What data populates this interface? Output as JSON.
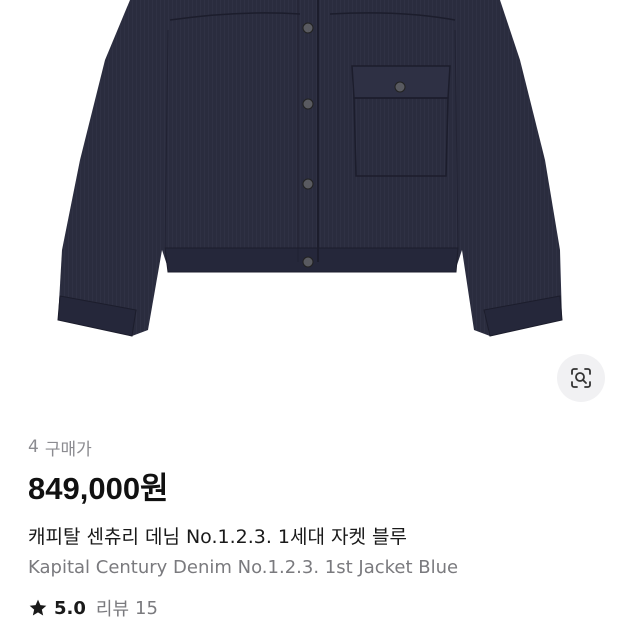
{
  "product": {
    "purchase_count": "4",
    "purchase_label": "구매가",
    "price": "849,000원",
    "title_ko": "캐피탈 센츄리 데님 No.1.2.3. 1세대 자켓 블루",
    "title_en": "Kapital Century Denim No.1.2.3. 1st Jacket Blue",
    "rating": "5.0",
    "review_label": "리뷰",
    "review_count": "15"
  },
  "icons": {
    "lens": "image-search-icon",
    "star": "star-icon"
  },
  "colors": {
    "jacket": "#2b2d3f",
    "accent_bg": "#f1f1f3",
    "muted_text": "#8b8b90",
    "star": "#1a1a1a"
  }
}
